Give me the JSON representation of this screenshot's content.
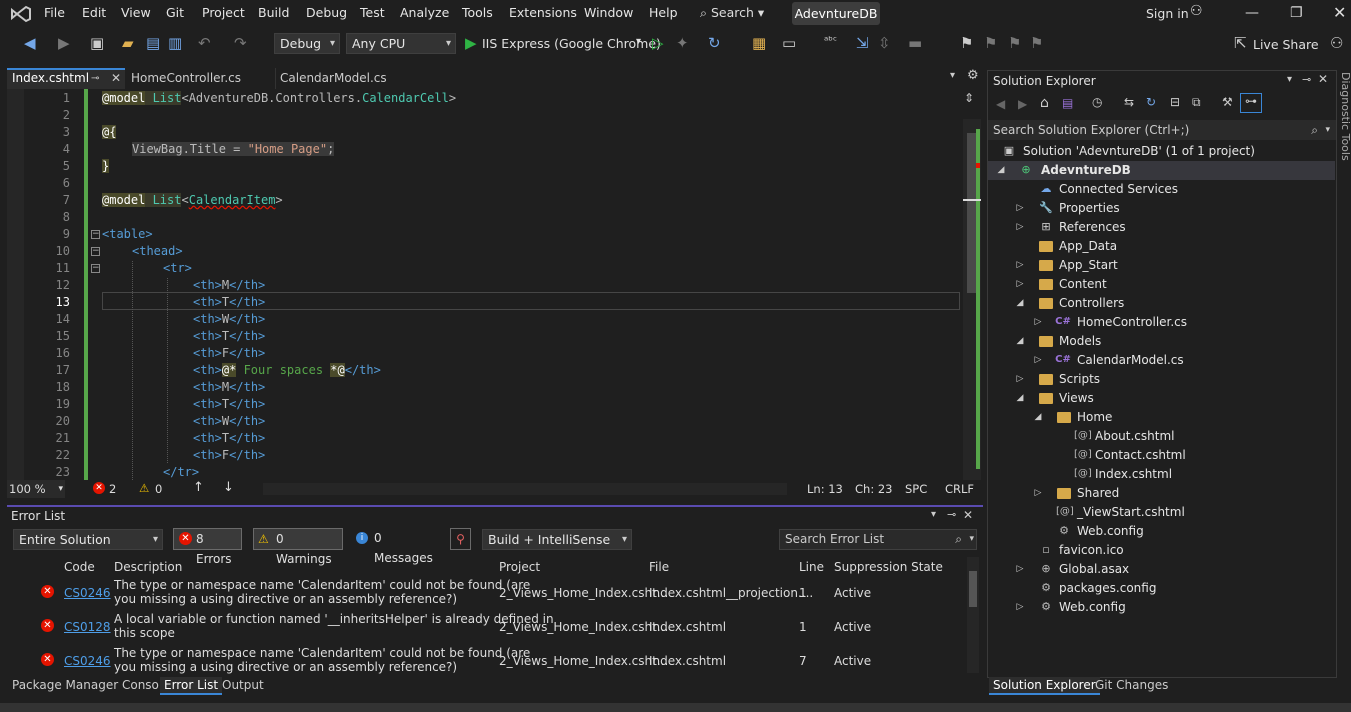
{
  "menu": {
    "items": [
      "File",
      "Edit",
      "View",
      "Git",
      "Project",
      "Build",
      "Debug",
      "Test",
      "Analyze",
      "Tools",
      "Extensions",
      "Window",
      "Help"
    ],
    "search": "Search",
    "solution_title": "AdevntureDB",
    "signin": "Sign in"
  },
  "toolbar": {
    "config": "Debug",
    "platform": "Any CPU",
    "run_target": "IIS Express (Google Chrome)",
    "live_share": "Live Share"
  },
  "tabs": [
    {
      "label": "Index.cshtml"
    },
    {
      "label": "HomeController.cs"
    },
    {
      "label": "CalendarModel.cs"
    }
  ],
  "editor": {
    "lines": [
      "1",
      "2",
      "3",
      "4",
      "5",
      "6",
      "7",
      "8",
      "9",
      "10",
      "11",
      "12",
      "13",
      "14",
      "15",
      "16",
      "17",
      "18",
      "19",
      "20",
      "21",
      "22",
      "23"
    ],
    "code": {
      "l1a": "@model",
      "l1b": " List",
      "l1c": "<AdventureDB.Controllers.",
      "l1d": "CalendarCell",
      "l3": "@{",
      "l4a": "ViewBag",
      "l4b": ".Title = ",
      "l4c": "\"Home Page\"",
      "l4d": ";",
      "l5": "}",
      "l7a": "@model",
      "l7b": " List",
      "l7c": "<",
      "l7d": "CalendarItem",
      "l7e": ">",
      "l9": "<table>",
      "l10": "<thead>",
      "l11": "<tr>",
      "th_open": "<th>",
      "th_close": "</th>",
      "days": [
        "M",
        "T",
        "W",
        "T",
        "F"
      ],
      "l17_open": "@*",
      "l17_comment": " Four spaces ",
      "l17_close": "*@",
      "days2": [
        "M",
        "T",
        "W",
        "T",
        "F"
      ],
      "l23": "</tr>"
    },
    "zoom": "100 %",
    "errors": "2",
    "warnings": "0",
    "position": {
      "ln": "Ln: 13",
      "ch": "Ch: 23",
      "spc": "SPC",
      "eol": "CRLF"
    }
  },
  "errorlist": {
    "title": "Error List",
    "scope": "Entire Solution",
    "errors_btn": "8 Errors",
    "warnings_btn": "0 Warnings",
    "messages_btn": "0 Messages",
    "source": "Build + IntelliSense",
    "search": "Search Error List",
    "headers": [
      "Code",
      "Description",
      "Project",
      "File",
      "Line",
      "Suppression State"
    ],
    "rows": [
      {
        "code": "CS0246",
        "desc1": "The type or namespace name 'CalendarItem' could not be found (are",
        "desc2": "you missing a using directive or an assembly reference?)",
        "project": "2_Views_Home_Index.csht...",
        "file": "Index.cshtml__projection....",
        "line": "1",
        "state": "Active"
      },
      {
        "code": "CS0128",
        "desc1": "A local variable or function named '__inheritsHelper' is already defined in",
        "desc2": "this scope",
        "project": "2_Views_Home_Index.csht...",
        "file": "Index.cshtml",
        "line": "1",
        "state": "Active"
      },
      {
        "code": "CS0246",
        "desc1": "The type or namespace name 'CalendarItem' could not be found (are",
        "desc2": "you missing a using directive or an assembly reference?)",
        "project": "2_Views_Home_Index.csht...",
        "file": "Index.cshtml",
        "line": "7",
        "state": "Active"
      }
    ]
  },
  "bottom_tabs": [
    "Package Manager Console",
    "Error List",
    "Output"
  ],
  "solution_explorer": {
    "title": "Solution Explorer",
    "search": "Search Solution Explorer (Ctrl+;)",
    "solution": "Solution 'AdevntureDB' (1 of 1 project)",
    "project": "AdevntureDB",
    "items": [
      "Connected Services",
      "Properties",
      "References",
      "App_Data",
      "App_Start",
      "Content",
      "Controllers",
      "HomeController.cs",
      "Models",
      "CalendarModel.cs",
      "Scripts",
      "Views",
      "Home",
      "About.cshtml",
      "Contact.cshtml",
      "Index.cshtml",
      "Shared",
      "_ViewStart.cshtml",
      "Web.config",
      "favicon.ico",
      "Global.asax",
      "packages.config",
      "Web.config"
    ],
    "bottom_tabs": [
      "Solution Explorer",
      "Git Changes"
    ]
  },
  "side_label": "Diagnostic Tools"
}
